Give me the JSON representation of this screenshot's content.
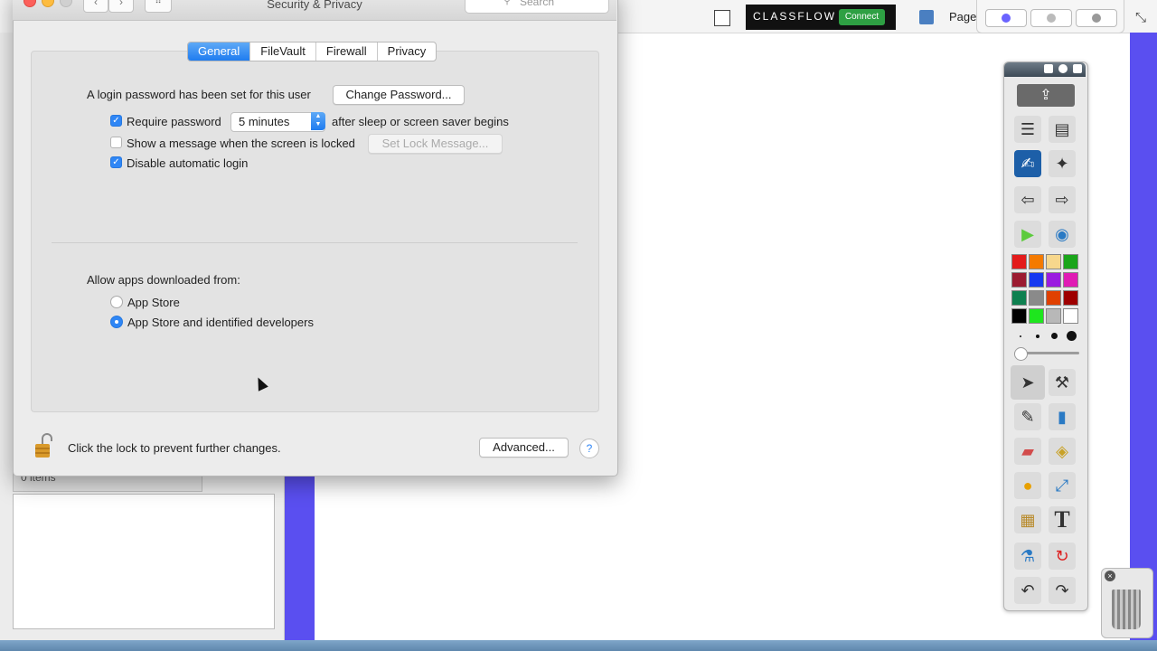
{
  "window": {
    "title": "Security & Privacy",
    "search_placeholder": "Search",
    "back_icon": "‹",
    "forward_icon": "›",
    "grid_icon": "⠿"
  },
  "tabs": [
    {
      "label": "General",
      "active": true
    },
    {
      "label": "FileVault",
      "active": false
    },
    {
      "label": "Firewall",
      "active": false
    },
    {
      "label": "Privacy",
      "active": false
    }
  ],
  "general": {
    "login_text": "A login password has been set for this user",
    "change_password_label": "Change Password...",
    "require_password_label": "Require password",
    "require_password_checked": true,
    "require_interval": "5 minutes",
    "after_sleep_text": "after sleep or screen saver begins",
    "show_message_label": "Show a message when the screen is locked",
    "show_message_checked": false,
    "set_lock_message_label": "Set Lock Message...",
    "disable_login_label": "Disable automatic login",
    "disable_login_checked": true
  },
  "downloads": {
    "heading": "Allow apps downloaded from:",
    "options": [
      {
        "label": "App Store",
        "selected": false
      },
      {
        "label": "App Store and identified developers",
        "selected": true
      }
    ]
  },
  "footer": {
    "lock_text": "Click the lock to prevent further changes.",
    "advanced_label": "Advanced...",
    "help_label": "?"
  },
  "background_app": {
    "brand": "CLASSFLOW",
    "connect_label": "Connect",
    "page_label": "Page",
    "items_label": "0 items",
    "share_icon": "⇪",
    "trash_close": "×"
  },
  "palette_colors": [
    "#e31b1b",
    "#f47a00",
    "#f7d78c",
    "#1aa51a",
    "#9b1b30",
    "#1638f0",
    "#9a1be0",
    "#e01bb4",
    "#0e8050",
    "#8a8a8a",
    "#e04000",
    "#9e0000",
    "#000000",
    "#1ee61e",
    "#b8b8b8",
    "#ffffff"
  ],
  "colors": {
    "accent": "#2f86f5",
    "purple_bg": "#5a4ff0"
  }
}
